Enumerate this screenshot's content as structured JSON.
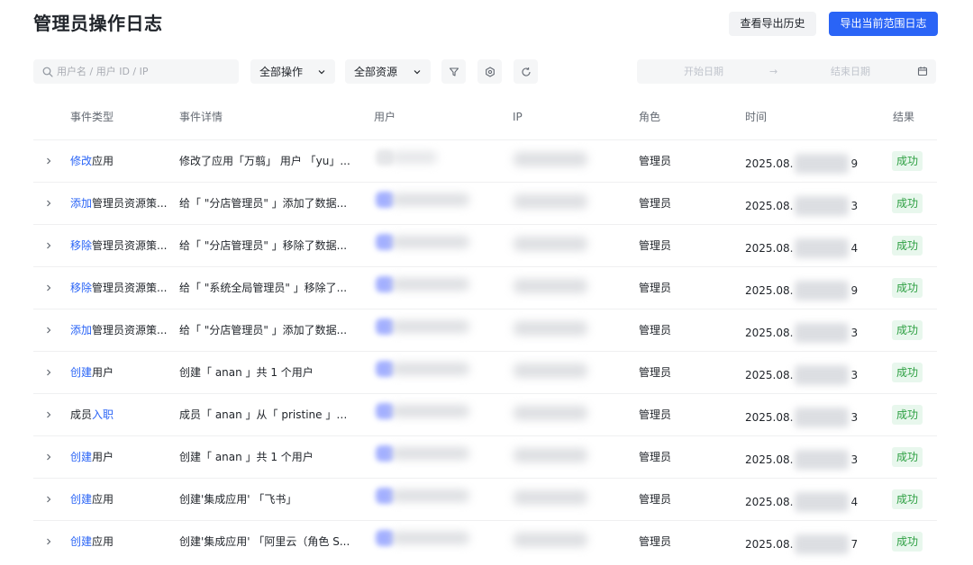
{
  "page": {
    "title": "管理员操作日志"
  },
  "header": {
    "history_label": "查看导出历史",
    "export_label": "导出当前范围日志"
  },
  "filters": {
    "search_placeholder": "用户名 / 用户 ID / IP",
    "operation_select": "全部操作",
    "resource_select": "全部资源",
    "date_start_placeholder": "开始日期",
    "date_arrow": "→",
    "date_end_placeholder": "结束日期"
  },
  "icons": [
    "search-icon",
    "chevron-down-icon",
    "filter-icon",
    "gear-icon",
    "refresh-icon",
    "calendar-icon",
    "chevron-right-icon"
  ],
  "colors": {
    "accent": "#2a64f6",
    "success_text": "#2ea043",
    "success_bg": "#e8f7ed"
  },
  "table": {
    "columns": [
      "事件类型",
      "事件详情",
      "用户",
      "IP",
      "角色",
      "时间",
      "结果"
    ],
    "rows": [
      {
        "verb": "修改",
        "object": "应用",
        "detail": "修改了应用「万翦」 用户 「yu」...",
        "role": "管理员",
        "time_prefix": "2025.08.",
        "time_suffix": "9",
        "result": "成功"
      },
      {
        "verb": "添加",
        "object": "管理员资源策...",
        "detail": "给「 \"分店管理员\" 」添加了数据...",
        "role": "管理员",
        "time_prefix": "2025.08.",
        "time_suffix": "3",
        "result": "成功"
      },
      {
        "verb": "移除",
        "object": "管理员资源策...",
        "detail": "给「 \"分店管理员\" 」移除了数据...",
        "role": "管理员",
        "time_prefix": "2025.08.",
        "time_suffix": "4",
        "result": "成功"
      },
      {
        "verb": "移除",
        "object": "管理员资源策...",
        "detail": "给「 \"系统全局管理员\" 」移除了...",
        "role": "管理员",
        "time_prefix": "2025.08.",
        "time_suffix": "9",
        "result": "成功"
      },
      {
        "verb": "添加",
        "object": "管理员资源策...",
        "detail": "给「 \"分店管理员\" 」添加了数据...",
        "role": "管理员",
        "time_prefix": "2025.08.",
        "time_suffix": "3",
        "result": "成功"
      },
      {
        "verb": "创建",
        "object": "用户",
        "detail": "创建「 anan 」共 1 个用户",
        "role": "管理员",
        "time_prefix": "2025.08.",
        "time_suffix": "3",
        "result": "成功"
      },
      {
        "prefix": "成员",
        "verb": "入职",
        "object": "",
        "detail": "成员「 anan 」从「 pristine 」部...",
        "role": "管理员",
        "time_prefix": "2025.08.",
        "time_suffix": "3",
        "result": "成功"
      },
      {
        "verb": "创建",
        "object": "用户",
        "detail": "创建「 anan 」共 1 个用户",
        "role": "管理员",
        "time_prefix": "2025.08.",
        "time_suffix": "3",
        "result": "成功"
      },
      {
        "verb": "创建",
        "object": "应用",
        "detail": "创建'集成应用' 「飞书」",
        "role": "管理员",
        "time_prefix": "2025.08.",
        "time_suffix": "4",
        "result": "成功"
      },
      {
        "verb": "创建",
        "object": "应用",
        "detail": "创建'集成应用' 「阿里云（角色 S...",
        "role": "管理员",
        "time_prefix": "2025.08.",
        "time_suffix": "7",
        "result": "成功"
      }
    ]
  }
}
